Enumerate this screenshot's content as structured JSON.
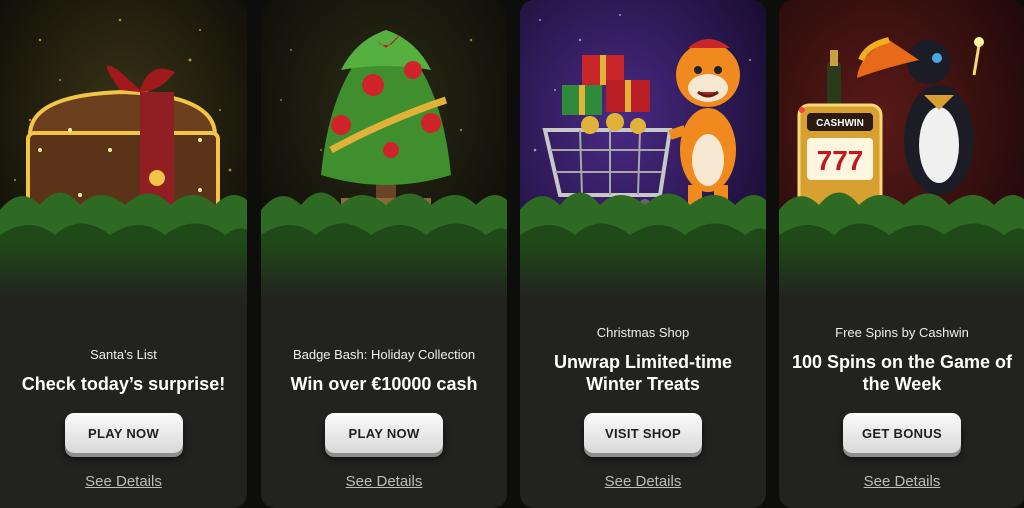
{
  "promos": [
    {
      "subtitle": "Santa's List",
      "title": "Check today’s surprise!",
      "button_label": "PLAY NOW",
      "details_label": "See Details",
      "illustration": "treasure-chest-with-red-bow",
      "bg_color": "#1a1a10"
    },
    {
      "subtitle": "Badge Bash: Holiday Collection",
      "title": "Win over €10000 cash",
      "button_label": "PLAY NOW",
      "details_label": "See Details",
      "illustration": "palm-christmas-tree",
      "bg_color": "#181812"
    },
    {
      "subtitle": "Christmas Shop",
      "title_line1": "Unwrap Limited-time",
      "title_line2": "Winter Treats",
      "button_label": "VISIT SHOP",
      "details_label": "See Details",
      "illustration": "tiger-with-shopping-cart",
      "bg_color": "#2a1a4a"
    },
    {
      "subtitle": "Free Spins by Cashwin",
      "title_line1": "100 Spins on the Game of",
      "title_line2": "the Week",
      "button_label": "GET BONUS",
      "details_label": "See Details",
      "illustration": "toucan-with-slot-machine",
      "slot_sign": "CASHWIN",
      "slot_digits": "777",
      "bg_color": "#3a0f10"
    }
  ]
}
